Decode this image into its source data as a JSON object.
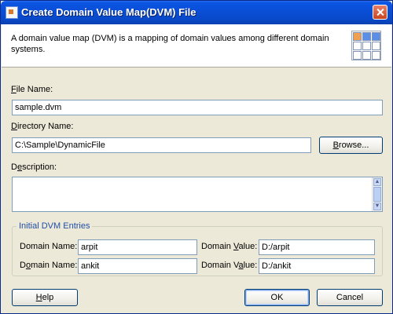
{
  "window": {
    "title": "Create Domain Value Map(DVM) File"
  },
  "info": {
    "text": "A domain value map (DVM) is a mapping of domain values among different domain systems."
  },
  "file_name": {
    "label_first": "F",
    "label_rest": "ile Name:",
    "value": "sample.dvm"
  },
  "directory": {
    "label_first": "D",
    "label_rest": "irectory Name:",
    "value": "C:\\Sample\\DynamicFile",
    "browse_first": "B",
    "browse_rest": "rowse..."
  },
  "description": {
    "label_pre": "D",
    "label_u": "e",
    "label_rest": "scription:",
    "value": ""
  },
  "dvm_entries": {
    "title": "Initial DVM Entries",
    "rows": [
      {
        "name_label_pre": "Domain Name: ",
        "name_value": "arpit",
        "value_label_pre": "Domain ",
        "value_label_u": "V",
        "value_label_rest": "alue:",
        "value_value": "D:/arpit"
      },
      {
        "name_label_pre": "D",
        "name_label_u": "o",
        "name_label_rest": "main Name:",
        "name_value": "ankit",
        "value_label_pre": "Domain V",
        "value_label_u": "a",
        "value_label_rest": "lue:",
        "value_value": "D:/ankit"
      }
    ]
  },
  "buttons": {
    "help_first": "H",
    "help_rest": "elp",
    "ok": "OK",
    "cancel": "Cancel"
  }
}
